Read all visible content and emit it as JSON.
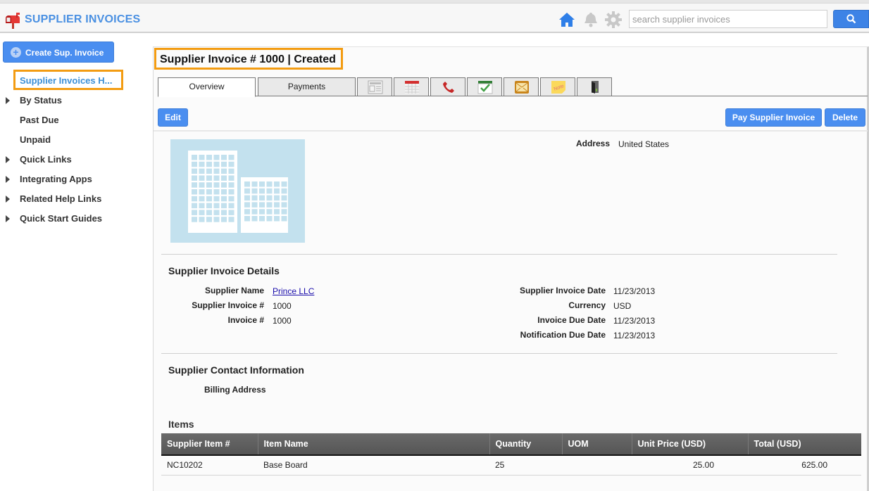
{
  "header": {
    "app_title": "SUPPLIER INVOICES",
    "search_placeholder": "search supplier invoices",
    "icons": [
      "mailbox-logo-icon",
      "home-icon",
      "bell-icon",
      "gear-icon",
      "search-icon"
    ]
  },
  "sidebar": {
    "create_label": "Create Sup. Invoice",
    "active_item": "Supplier Invoices H...",
    "items": [
      {
        "label": "By Status",
        "expandable": true
      },
      {
        "label": "Past Due",
        "expandable": false
      },
      {
        "label": "Unpaid",
        "expandable": false
      },
      {
        "label": "Quick Links",
        "expandable": true
      },
      {
        "label": "Integrating Apps",
        "expandable": true
      },
      {
        "label": "Related Help Links",
        "expandable": true
      },
      {
        "label": "Quick Start Guides",
        "expandable": true
      }
    ]
  },
  "main": {
    "title": "Supplier Invoice # 1000  |  Created",
    "tabs": [
      {
        "label": "Overview",
        "active": true
      },
      {
        "label": "Payments",
        "active": false
      }
    ],
    "icon_tabs": [
      "news-icon",
      "calendar-icon",
      "phone-icon",
      "task-check-icon",
      "email-icon",
      "note-icon",
      "door-exit-icon"
    ],
    "buttons": {
      "edit": "Edit",
      "pay": "Pay Supplier Invoice",
      "delete": "Delete"
    },
    "address": {
      "label": "Address",
      "value": "United States"
    },
    "details": {
      "title": "Supplier Invoice Details",
      "left": [
        {
          "label": "Supplier Name",
          "value": "Prince LLC",
          "link": true
        },
        {
          "label": "Supplier Invoice #",
          "value": "1000"
        },
        {
          "label": "Invoice #",
          "value": "1000"
        }
      ],
      "right": [
        {
          "label": "Supplier Invoice Date",
          "value": "11/23/2013"
        },
        {
          "label": "Currency",
          "value": "USD"
        },
        {
          "label": "Invoice Due Date",
          "value": "11/23/2013"
        },
        {
          "label": "Notification Due Date",
          "value": "11/23/2013"
        }
      ]
    },
    "contact": {
      "title": "Supplier Contact Information",
      "billing_label": "Billing Address"
    },
    "items": {
      "title": "Items",
      "columns": [
        "Supplier Item #",
        "Item Name",
        "Quantity",
        "UOM",
        "Unit Price (USD)",
        "Total (USD)"
      ],
      "rows": [
        [
          "NC10202",
          "Base Board",
          "25",
          "",
          "25.00",
          "625.00"
        ]
      ]
    }
  },
  "colors": {
    "accent": "#4a8ef0",
    "highlight_border": "#f39c12",
    "title_blue": "#4a90e2"
  }
}
